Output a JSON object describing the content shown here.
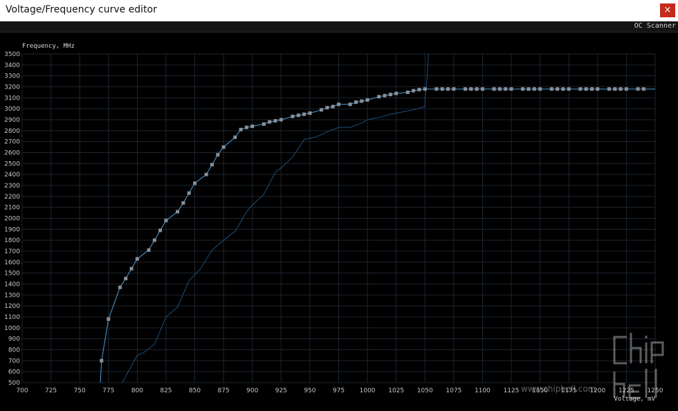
{
  "window": {
    "title": "Voltage/Frequency curve editor",
    "close_glyph": "×",
    "close_icon": "close-icon"
  },
  "toolbar": {
    "oc_scanner_label": "OC Scanner"
  },
  "watermark": {
    "brand": "chiphell",
    "url": "www.chiphell.com"
  },
  "colors": {
    "background": "#000000",
    "grid": "#1d2630",
    "curve": "#4aa0e0",
    "baseline": "#1d4f7a",
    "point": "#8a8f96",
    "close_button": "#c42b1c"
  },
  "chart_data": {
    "type": "line",
    "title": "",
    "xlabel": "Voltage, mV",
    "ylabel": "Frequency, MHz",
    "xlim": [
      700,
      1250
    ],
    "ylim": [
      500,
      3500
    ],
    "x_ticks": [
      700,
      725,
      750,
      775,
      800,
      825,
      850,
      875,
      900,
      925,
      950,
      975,
      1000,
      1025,
      1050,
      1075,
      1100,
      1125,
      1150,
      1175,
      1200,
      1225,
      1250
    ],
    "y_ticks": [
      500,
      600,
      700,
      800,
      900,
      1000,
      1100,
      1200,
      1300,
      1400,
      1500,
      1600,
      1700,
      1800,
      1900,
      2000,
      2100,
      2200,
      2300,
      2400,
      2500,
      2600,
      2700,
      2800,
      2900,
      3000,
      3100,
      3200,
      3300,
      3400,
      3500
    ],
    "grid": true,
    "series": [
      {
        "kind": "curve",
        "x": [
          768,
          769,
          775,
          785,
          790,
          795,
          800,
          810,
          815,
          820,
          825,
          835,
          840,
          845,
          850,
          860,
          865,
          870,
          875,
          885,
          890,
          895,
          900,
          910,
          915,
          920,
          925,
          935,
          940,
          945,
          950,
          960,
          965,
          970,
          975,
          985,
          990,
          995,
          1000,
          1010,
          1015,
          1020,
          1025,
          1035,
          1040,
          1045,
          1050,
          1060,
          1065,
          1070,
          1075,
          1085,
          1090,
          1095,
          1100,
          1110,
          1115,
          1120,
          1125,
          1135,
          1140,
          1145,
          1150,
          1160,
          1165,
          1170,
          1175,
          1185,
          1190,
          1195,
          1200,
          1210,
          1215,
          1220,
          1225,
          1235,
          1240,
          1250
        ],
        "y": [
          500,
          700,
          1080,
          1370,
          1450,
          1540,
          1630,
          1710,
          1800,
          1890,
          1980,
          2060,
          2140,
          2230,
          2320,
          2400,
          2490,
          2580,
          2650,
          2740,
          2810,
          2830,
          2840,
          2860,
          2880,
          2890,
          2900,
          2930,
          2940,
          2950,
          2960,
          2990,
          3010,
          3020,
          3040,
          3040,
          3060,
          3070,
          3080,
          3110,
          3120,
          3130,
          3140,
          3150,
          3165,
          3175,
          3180,
          3180,
          3180,
          3180,
          3180,
          3180,
          3180,
          3180,
          3180,
          3180,
          3180,
          3180,
          3180,
          3180,
          3180,
          3180,
          3180,
          3180,
          3180,
          3180,
          3180,
          3180,
          3180,
          3180,
          3180,
          3180,
          3180,
          3180,
          3180,
          3180,
          3180,
          3180
        ],
        "markers": [
          769,
          775,
          785,
          790,
          795,
          800,
          810,
          815,
          820,
          825,
          835,
          840,
          845,
          850,
          860,
          865,
          870,
          875,
          885,
          890,
          895,
          900,
          910,
          915,
          920,
          925,
          935,
          940,
          945,
          950,
          960,
          965,
          970,
          975,
          985,
          990,
          995,
          1000,
          1010,
          1015,
          1020,
          1025,
          1035,
          1040,
          1045,
          1050,
          1060,
          1065,
          1070,
          1075,
          1085,
          1090,
          1095,
          1100,
          1110,
          1115,
          1120,
          1125,
          1135,
          1140,
          1145,
          1150,
          1160,
          1165,
          1170,
          1175,
          1185,
          1190,
          1195,
          1200,
          1210,
          1215,
          1220,
          1225,
          1235,
          1240
        ]
      },
      {
        "kind": "baseline",
        "x": [
          787,
          800,
          805,
          815,
          825,
          835,
          845,
          855,
          865,
          875,
          885,
          895,
          900,
          910,
          920,
          925,
          935,
          945,
          955,
          965,
          975,
          985,
          995,
          1000,
          1010,
          1020,
          1030,
          1040,
          1050,
          1050,
          1052,
          1053
        ],
        "y": [
          500,
          750,
          770,
          850,
          1100,
          1190,
          1430,
          1540,
          1710,
          1800,
          1880,
          2060,
          2120,
          2220,
          2420,
          2460,
          2560,
          2720,
          2740,
          2790,
          2830,
          2830,
          2870,
          2900,
          2920,
          2950,
          2970,
          2990,
          3020,
          3080,
          3300,
          3500
        ]
      }
    ]
  }
}
